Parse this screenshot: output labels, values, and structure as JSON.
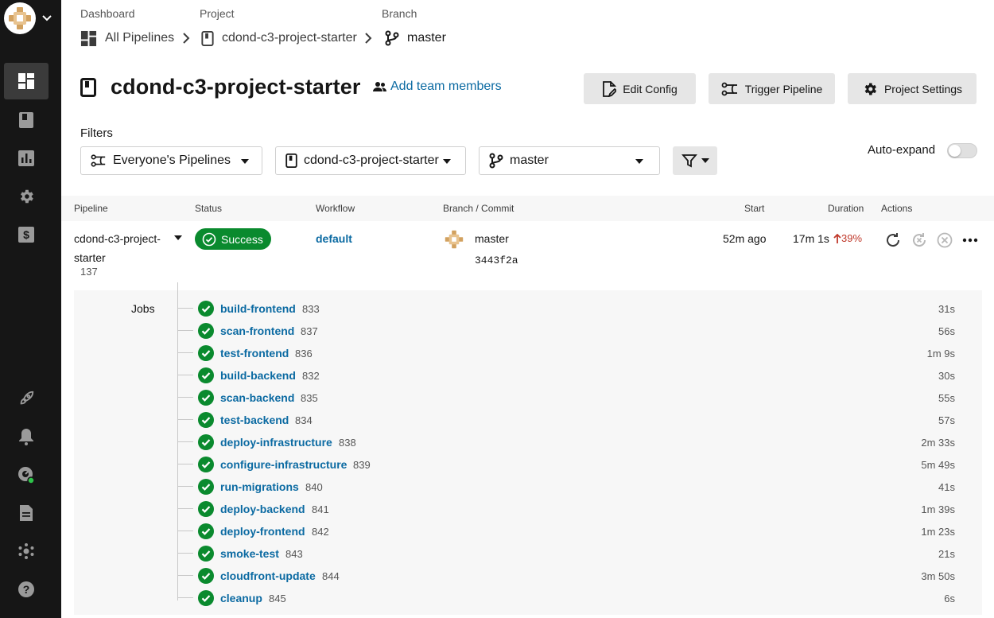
{
  "sidebar": {
    "items": [
      {
        "name": "dashboard-icon",
        "active": true
      },
      {
        "name": "projects-icon",
        "active": false
      },
      {
        "name": "insights-icon",
        "active": false
      },
      {
        "name": "settings-icon",
        "active": false
      },
      {
        "name": "plan-icon",
        "active": false
      },
      {
        "name": "rocket-icon",
        "active": false
      },
      {
        "name": "bell-icon",
        "active": false
      },
      {
        "name": "status-icon",
        "active": false
      },
      {
        "name": "docs-icon",
        "active": false
      },
      {
        "name": "community-icon",
        "active": false
      },
      {
        "name": "help-icon",
        "active": false
      }
    ]
  },
  "breadcrumb": {
    "dashboard_label": "Dashboard",
    "dashboard_value": "All Pipelines",
    "project_label": "Project",
    "project_value": "cdond-c3-project-starter",
    "branch_label": "Branch",
    "branch_value": "master"
  },
  "header": {
    "title": "cdond-c3-project-starter",
    "add_team": "Add team members",
    "edit_config": "Edit Config",
    "trigger_pipeline": "Trigger Pipeline",
    "project_settings": "Project Settings"
  },
  "filters": {
    "label": "Filters",
    "pipelines": "Everyone's Pipelines",
    "project": "cdond-c3-project-starter",
    "branch": "master",
    "auto_expand": "Auto-expand",
    "auto_expand_on": false
  },
  "table": {
    "headers": {
      "pipeline": "Pipeline",
      "status": "Status",
      "workflow": "Workflow",
      "branch_commit": "Branch / Commit",
      "start": "Start",
      "duration": "Duration",
      "actions": "Actions"
    },
    "row": {
      "name": "cdond-c3-project-starter",
      "number": "137",
      "status": "Success",
      "workflow": "default",
      "branch": "master",
      "commit": "3443f2a",
      "start": "52m ago",
      "duration": "17m 1s",
      "duration_change": "39%"
    }
  },
  "jobs": {
    "label": "Jobs",
    "items": [
      {
        "name": "build-frontend",
        "num": "833",
        "dur": "31s"
      },
      {
        "name": "scan-frontend",
        "num": "837",
        "dur": "56s"
      },
      {
        "name": "test-frontend",
        "num": "836",
        "dur": "1m 9s"
      },
      {
        "name": "build-backend",
        "num": "832",
        "dur": "30s"
      },
      {
        "name": "scan-backend",
        "num": "835",
        "dur": "55s"
      },
      {
        "name": "test-backend",
        "num": "834",
        "dur": "57s"
      },
      {
        "name": "deploy-infrastructure",
        "num": "838",
        "dur": "2m 33s"
      },
      {
        "name": "configure-infrastructure",
        "num": "839",
        "dur": "5m 49s"
      },
      {
        "name": "run-migrations",
        "num": "840",
        "dur": "41s"
      },
      {
        "name": "deploy-backend",
        "num": "841",
        "dur": "1m 39s"
      },
      {
        "name": "deploy-frontend",
        "num": "842",
        "dur": "1m 23s"
      },
      {
        "name": "smoke-test",
        "num": "843",
        "dur": "21s"
      },
      {
        "name": "cloudfront-update",
        "num": "844",
        "dur": "3m 50s"
      },
      {
        "name": "cleanup",
        "num": "845",
        "dur": "6s"
      }
    ]
  },
  "colors": {
    "sidebar": "#161616",
    "link": "#0b6aa2",
    "success": "#0a8a2e",
    "increase": "#c0392b"
  }
}
